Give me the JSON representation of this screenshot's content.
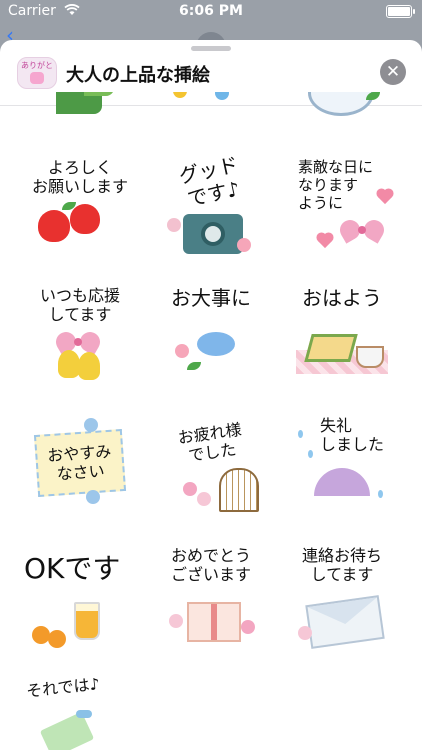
{
  "status_bar": {
    "carrier": "Carrier",
    "time": "6:06 PM"
  },
  "header": {
    "app_name": "大人の上品な挿絵",
    "icon_text": "ありがとう",
    "close_icon": "close-icon"
  },
  "stickers": [
    {
      "text": ""
    },
    {
      "text": ""
    },
    {
      "text": ""
    },
    {
      "text": "よろしく\nお願いします"
    },
    {
      "text": "グッド\nです♪"
    },
    {
      "text": "素敵な日に\nなります\nように"
    },
    {
      "text": "いつも応援\nしてます"
    },
    {
      "text": "お大事に"
    },
    {
      "text": "おはよう"
    },
    {
      "text": "おやすみ\nなさい"
    },
    {
      "text": "お疲れ様\nでした"
    },
    {
      "text": "失礼\nしました"
    },
    {
      "text": "OKです"
    },
    {
      "text": "おめでとう\nございます"
    },
    {
      "text": "連絡お待ち\nしてます"
    },
    {
      "text": "それでは♪"
    }
  ]
}
